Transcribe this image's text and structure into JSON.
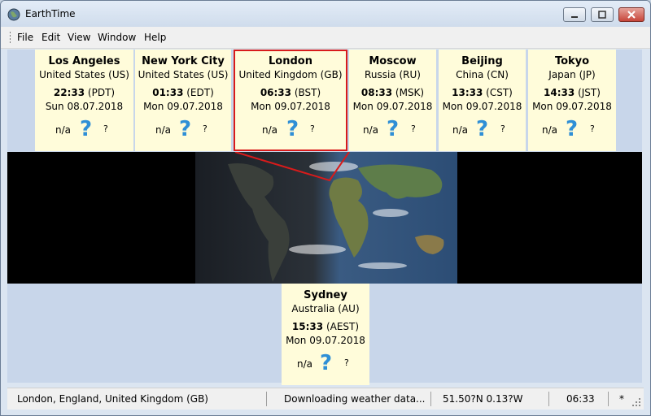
{
  "window": {
    "title": "EarthTime"
  },
  "menu": [
    "File",
    "Edit",
    "View",
    "Window",
    "Help"
  ],
  "cities": [
    {
      "name": "Los Angeles",
      "country": "United States (US)",
      "time": "22:33",
      "zone": "(PDT)",
      "date": "Sun 08.07.2018",
      "weather_temp": "n/a",
      "weather_icon": "?",
      "weather_extra": "?",
      "selected": false
    },
    {
      "name": "New York City",
      "country": "United States (US)",
      "time": "01:33",
      "zone": "(EDT)",
      "date": "Mon 09.07.2018",
      "weather_temp": "n/a",
      "weather_icon": "?",
      "weather_extra": "?",
      "selected": false
    },
    {
      "name": "London",
      "country": "United Kingdom (GB)",
      "time": "06:33",
      "zone": "(BST)",
      "date": "Mon 09.07.2018",
      "weather_temp": "n/a",
      "weather_icon": "?",
      "weather_extra": "?",
      "selected": true
    },
    {
      "name": "Moscow",
      "country": "Russia (RU)",
      "time": "08:33",
      "zone": "(MSK)",
      "date": "Mon 09.07.2018",
      "weather_temp": "n/a",
      "weather_icon": "?",
      "weather_extra": "?",
      "selected": false
    },
    {
      "name": "Beijing",
      "country": "China (CN)",
      "time": "13:33",
      "zone": "(CST)",
      "date": "Mon 09.07.2018",
      "weather_temp": "n/a",
      "weather_icon": "?",
      "weather_extra": "?",
      "selected": false
    },
    {
      "name": "Tokyo",
      "country": "Japan (JP)",
      "time": "14:33",
      "zone": "(JST)",
      "date": "Mon 09.07.2018",
      "weather_temp": "n/a",
      "weather_icon": "?",
      "weather_extra": "?",
      "selected": false
    },
    {
      "name": "Sydney",
      "country": "Australia (AU)",
      "time": "15:33",
      "zone": "(AEST)",
      "date": "Mon 09.07.2018",
      "weather_temp": "n/a",
      "weather_icon": "?",
      "weather_extra": "?",
      "selected": false
    }
  ],
  "status": {
    "location": "London, England, United Kingdom (GB)",
    "message": "Downloading weather data...",
    "coords": "51.50?N  0.13?W",
    "time": "06:33",
    "flag": "*"
  },
  "colors": {
    "card_bg": "#fffcda",
    "selection": "#d81b1b",
    "weather_icon": "#2f8fd6"
  }
}
